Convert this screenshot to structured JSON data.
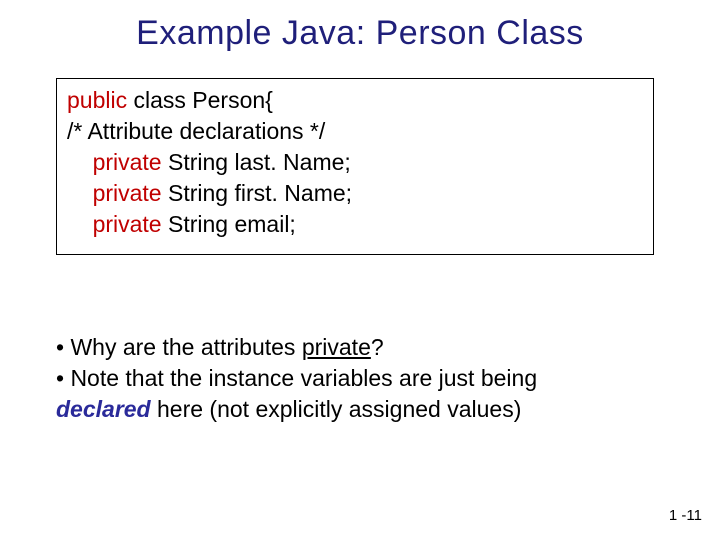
{
  "title": "Example Java: Person Class",
  "code": {
    "l1a": "public",
    "l1b": " class Person{",
    "l2": "/* Attribute declarations */",
    "l3a": "    ",
    "l3b": "private",
    "l3c": " String last. Name;",
    "l4a": "    ",
    "l4b": "private",
    "l4c": " String first. Name;",
    "l5a": "    ",
    "l5b": "private",
    "l5c": " String email;"
  },
  "bullets": {
    "b1a": "• Why are the attributes ",
    "b1u": "private",
    "b1b": "?",
    "b2": "• Note that the instance variables are just being",
    "b3a": "declared",
    "b3b": " here (not explicitly assigned values)"
  },
  "pagenum": "1 -11"
}
